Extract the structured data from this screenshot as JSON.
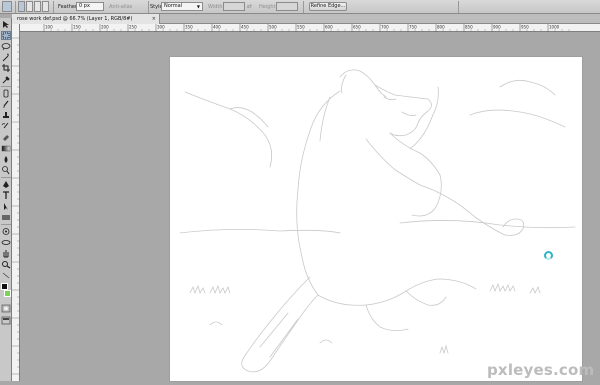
{
  "options_bar": {
    "feather_label": "Feather:",
    "feather_value": "0 px",
    "antialias_label": "Anti-alias",
    "style_label": "Style:",
    "style_value": "Normal",
    "width_label": "Width:",
    "height_label": "Height:",
    "refine_edge_label": "Refine Edge..."
  },
  "document_tab": {
    "title": "rose work def.psd @ 66.7% (Layer 1, RGB/8#)",
    "close_glyph": "×"
  },
  "ruler": {
    "labels": [
      "100",
      "150",
      "200",
      "250",
      "300",
      "350",
      "400",
      "450",
      "500",
      "550",
      "600",
      "650",
      "700",
      "750",
      "800",
      "850",
      "900",
      "950",
      "1000"
    ]
  },
  "colors": {
    "foreground": "#111111",
    "background": "#7dd35a",
    "busy_cursor": "#2ab5c6"
  },
  "watermark": "pxleyes.com"
}
